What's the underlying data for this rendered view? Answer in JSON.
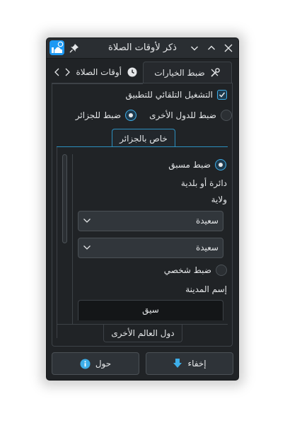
{
  "window": {
    "title": "ذكر لأوقات الصلاة"
  },
  "tabs": [
    {
      "label": "ضبط الخيارات",
      "icon": "wrench-icon"
    },
    {
      "label": "أوقات الصلاة",
      "icon": "clock-icon"
    }
  ],
  "options": {
    "autostart_label": "التشغيل التلقائي للتطبيق",
    "autostart_checked": true,
    "region_other_label": "ضبط للدول الأخرى",
    "region_algeria_label": "ضبط للجزائر",
    "region_selected": "algeria"
  },
  "subtabs": {
    "algeria": "خاص بالجزائر",
    "other": "دول العالم الأخرى"
  },
  "algeria": {
    "preset_label": "ضبط مسبق",
    "circle_label": "دائرة أو بلدية",
    "wilaya_label": "ولاية",
    "combo1_value": "سعيدة",
    "combo2_value": "سعيدة",
    "custom_label": "ضبط شخصي",
    "city_name_label": "إسم المدينة",
    "city_value": "سيق"
  },
  "buttons": {
    "hide": "إخفاء",
    "about": "حول"
  },
  "colors": {
    "accent": "#3daee9",
    "window_bg": "#202326",
    "titlebar_bg": "#2a2e32"
  }
}
